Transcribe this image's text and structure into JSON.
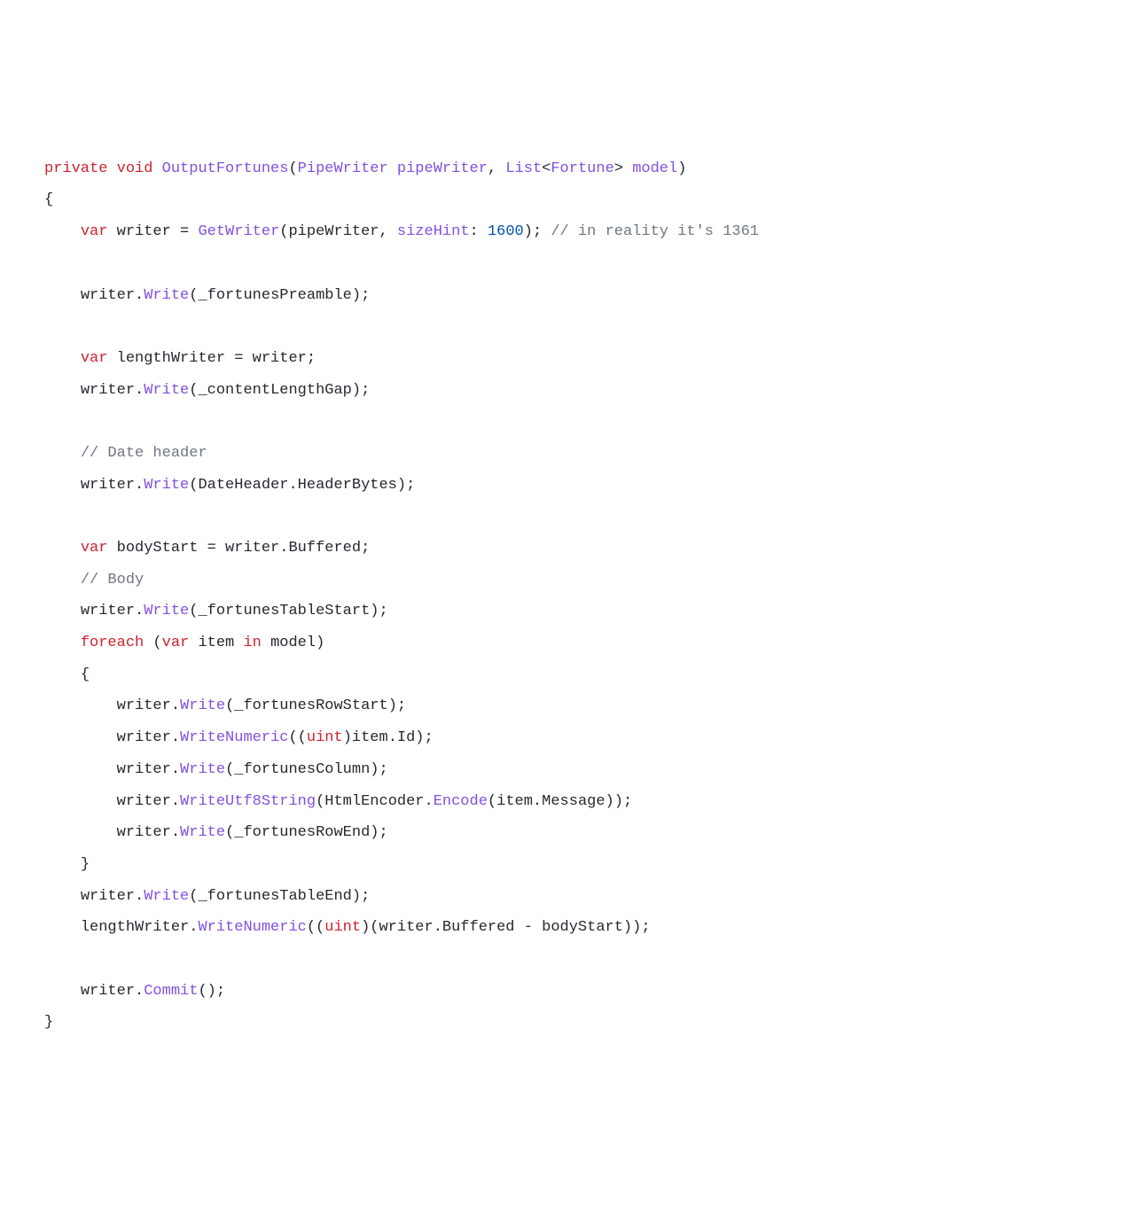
{
  "code": {
    "kw_private": "private",
    "kw_void": "void",
    "fn_OutputFortunes": "OutputFortunes",
    "lparen1": "(",
    "type_PipeWriter": "PipeWriter",
    "sp": " ",
    "param_pipeWriter": "pipeWriter",
    "comma1": ", ",
    "type_List": "List",
    "lt": "<",
    "type_Fortune": "Fortune",
    "gt": "> ",
    "param_model": "model",
    "rparen1": ")",
    "lbrace": "{",
    "rbrace": "}",
    "kw_var": "var",
    "id_writer": " writer ",
    "eq": "= ",
    "fn_GetWriter": "GetWriter",
    "args_GetWriter_a": "(pipeWriter, ",
    "arg_sizeHint": "sizeHint",
    "colon": ": ",
    "num_1600": "1600",
    "args_GetWriter_b": "); ",
    "cmt_1361": "// in reality it's 1361",
    "call_writer_dot": "writer.",
    "fn_Write": "Write",
    "arg_fortunesPreamble": "(_fortunesPreamble);",
    "id_lengthWriter_decl": " lengthWriter = writer;",
    "arg_contentLengthGap": "(_contentLengthGap);",
    "cmt_DateHeader": "// Date header",
    "arg_DateHeader": "(DateHeader.HeaderBytes);",
    "id_bodyStart_decl": " bodyStart = writer.Buffered;",
    "cmt_Body": "// Body",
    "arg_fortunesTableStart": "(_fortunesTableStart);",
    "kw_foreach": "foreach",
    "foreach_open": " (",
    "id_item": " item ",
    "kw_in": "in",
    "foreach_model": " model)",
    "arg_fortunesRowStart": "(_fortunesRowStart);",
    "fn_WriteNumeric": "WriteNumeric",
    "cast_open": "((",
    "kw_uint": "uint",
    "cast_itemId": ")item.Id);",
    "arg_fortunesColumn": "(_fortunesColumn);",
    "fn_WriteUtf8String": "WriteUtf8String",
    "arg_htmlenc_a": "(HtmlEncoder.",
    "fn_Encode": "Encode",
    "arg_htmlenc_b": "(item.Message));",
    "arg_fortunesRowEnd": "(_fortunesRowEnd);",
    "arg_fortunesTableEnd": "(_fortunesTableEnd);",
    "call_lengthWriter_dot": "lengthWriter.",
    "cast_buffered": ")(writer.Buffered - bodyStart));",
    "fn_Commit": "Commit",
    "commit_args": "();"
  }
}
